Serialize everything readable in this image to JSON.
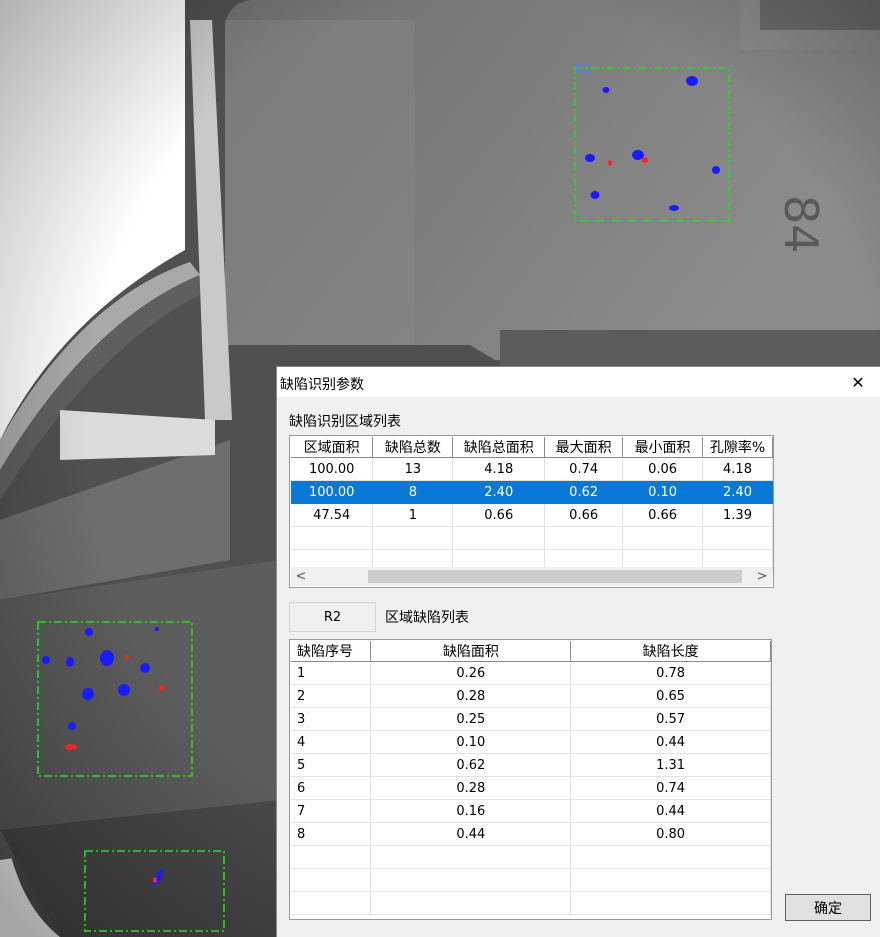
{
  "image": {
    "roi_label_1": "R2",
    "roi_label_2": "",
    "stamped_text": "84"
  },
  "dialog": {
    "title": "缺陷识别参数",
    "close_glyph": "✕",
    "region_list_label": "缺陷识别区域列表",
    "region_table": {
      "columns": [
        "区域面积",
        "缺陷总数",
        "缺陷总面积",
        "最大面积",
        "最小面积",
        "孔隙率%"
      ],
      "rows": [
        [
          "100.00",
          "13",
          "4.18",
          "0.74",
          "0.06",
          "4.18"
        ],
        [
          "100.00",
          "8",
          "2.40",
          "0.62",
          "0.10",
          "2.40"
        ],
        [
          "47.54",
          "1",
          "0.66",
          "0.66",
          "0.66",
          "1.39"
        ]
      ],
      "selected_row": 1
    },
    "scroll_left": "<",
    "scroll_right": ">",
    "current_region": "R2",
    "defect_list_label": "区域缺陷列表",
    "defect_table": {
      "columns": [
        "缺陷序号",
        "缺陷面积",
        "缺陷长度"
      ],
      "rows": [
        [
          "1",
          "0.26",
          "0.78"
        ],
        [
          "2",
          "0.28",
          "0.65"
        ],
        [
          "3",
          "0.25",
          "0.57"
        ],
        [
          "4",
          "0.10",
          "0.44"
        ],
        [
          "5",
          "0.62",
          "1.31"
        ],
        [
          "6",
          "0.28",
          "0.74"
        ],
        [
          "7",
          "0.16",
          "0.44"
        ],
        [
          "8",
          "0.44",
          "0.80"
        ]
      ]
    },
    "ok_label": "确定"
  },
  "colors": {
    "roi_box": "#22dd22",
    "defect_blue": "#1a1aff",
    "defect_red": "#ff2222",
    "selection": "#0a78d7"
  }
}
